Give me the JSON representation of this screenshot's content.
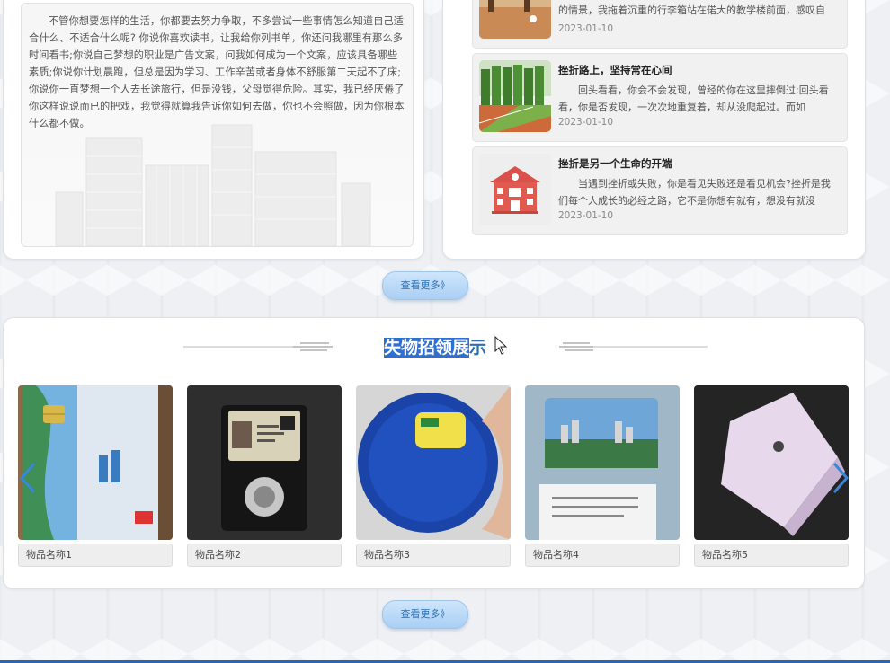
{
  "essay": {
    "text": "不管你想要怎样的生活，你都要去努力争取，不多尝试一些事情怎么知道自己适合什么、不适合什么呢? 你说你喜欢读书，让我给你列书单，你还问我哪里有那么多时间看书;你说自己梦想的职业是广告文案，问我如何成为一个文案，应该具备哪些素质;你说你计划晨跑，但总是因为学习、工作辛苦或者身体不舒服第二天起不了床;你说你一直梦想一个人去长途旅行，但是没钱，父母觉得危险。其实，我已经厌倦了你这样说说而已的把戏，我觉得就算我告诉你如何去做，你也不会照做，因为你根本什么都不做。"
  },
  "news": [
    {
      "title": "",
      "summary": "的情景，我拖着沉重的行李箱站在偌大的教学楼前面，感叹自",
      "date": "2023-01-10",
      "thumb_icon": "campus-tree-photo"
    },
    {
      "title": "挫折路上，坚持常在心间",
      "summary": "回头看看，你会不会发现，曾经的你在这里摔倒过;回头看看，你是否发现，一次次地重复着，却从没爬起过。而如",
      "date": "2023-01-10",
      "thumb_icon": "running-track-photo"
    },
    {
      "title": "挫折是另一个生命的开端",
      "summary": "当遇到挫折或失败，你是看见失败还是看见机会?挫折是我们每个人成长的必经之路，它不是你想有就有，想没有就没",
      "date": "2023-01-10",
      "thumb_icon": "school-building-icon"
    }
  ],
  "more_button_label": "查看更多》",
  "lost_found": {
    "title_selected": "失物招领展",
    "title_rest": "示",
    "items": [
      {
        "name": "物品名称1",
        "photo_icon": "bank-card-photo"
      },
      {
        "name": "物品名称2",
        "photo_icon": "badge-wallet-photo"
      },
      {
        "name": "物品名称3",
        "photo_icon": "cd-player-photo"
      },
      {
        "name": "物品名称4",
        "photo_icon": "transit-card-photo"
      },
      {
        "name": "物品名称5",
        "photo_icon": "key-case-photo"
      }
    ]
  },
  "colors": {
    "accent": "#2d6fb2",
    "button_top": "#cfe5fb",
    "button_bottom": "#a9cff4",
    "bottom_bar": "#2a66b8"
  }
}
